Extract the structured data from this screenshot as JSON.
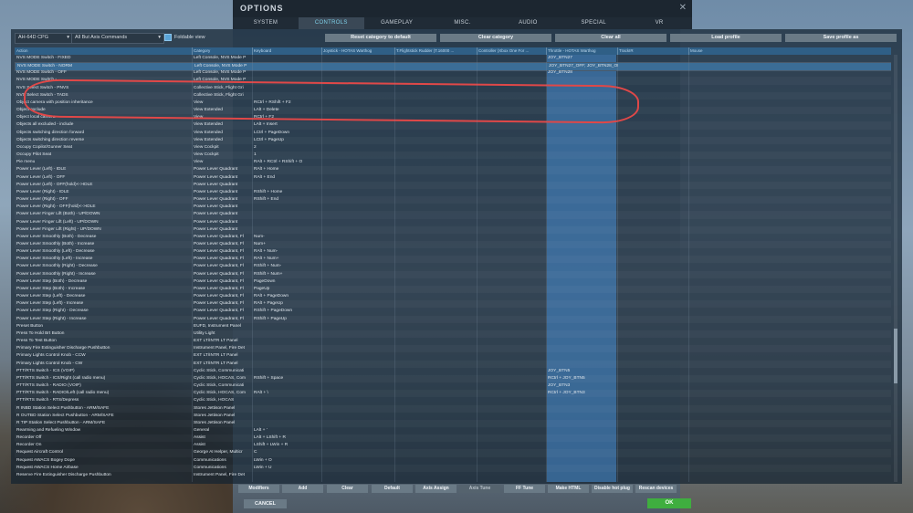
{
  "window": {
    "title": "OPTIONS",
    "close_glyph": "✕"
  },
  "tabs": [
    {
      "label": "SYSTEM"
    },
    {
      "label": "CONTROLS",
      "active": true
    },
    {
      "label": "GAMEPLAY"
    },
    {
      "label": "MISC."
    },
    {
      "label": "AUDIO"
    },
    {
      "label": "SPECIAL"
    },
    {
      "label": "VR"
    }
  ],
  "toolbar": {
    "aircraft": "AH-64D CPG",
    "category_filter": "All But Axis Commands",
    "foldable_label": "Foldable view",
    "foldable_checked": true,
    "reset_category": "Reset category to default",
    "clear_category": "Clear category",
    "clear_all": "Clear all",
    "load_profile": "Load profile",
    "save_profile": "Save profile as"
  },
  "columns": [
    "Action",
    "Category",
    "Keyboard",
    "Joystick - HOTAS Warthog",
    "T.Flightstick Rudder (T.16000 ...",
    "Controller (Xbox One For ...",
    "Throttle - HOTAS Warthog",
    "TrackIR",
    "Mouse"
  ],
  "rows": [
    [
      "NVS MODE Switch - FIXED",
      "Left Console, NVS Mode P",
      "",
      "",
      "",
      "",
      "JOY_BTN27",
      "",
      ""
    ],
    [
      "NVS MODE Switch - NORM",
      "Left Console, NVS Mode P",
      "",
      "",
      "",
      "",
      "JOY_BTN27_OFF; JOY_BTN28_OF",
      "",
      ""
    ],
    [
      "NVS MODE Switch - OFF",
      "Left Console, NVS Mode P",
      "",
      "",
      "",
      "",
      "JOY_BTN28",
      "",
      ""
    ],
    [
      "NVS MODE Switch - ...",
      "Left Console, NVS Mode P",
      "",
      "",
      "",
      "",
      "",
      "",
      ""
    ],
    [
      "NVS Select Switch - PNVS",
      "Collective Stick, Flight Gri",
      "",
      "",
      "",
      "",
      "",
      "",
      ""
    ],
    [
      "NVS Select Switch - TADS",
      "Collective Stick, Flight Gri",
      "",
      "",
      "",
      "",
      "",
      "",
      ""
    ],
    [
      "Object camera with position inheritance",
      "View",
      "RCtrl + RShift + F2",
      "",
      "",
      "",
      "",
      "",
      ""
    ],
    [
      "Object exclude",
      "View Extended",
      "LAlt + Delete",
      "",
      "",
      "",
      "",
      "",
      ""
    ],
    [
      "Object local camera",
      "View",
      "RCtrl + F2",
      "",
      "",
      "",
      "",
      "",
      ""
    ],
    [
      "Objects all excluded - include",
      "View Extended",
      "LAlt + Insert",
      "",
      "",
      "",
      "",
      "",
      ""
    ],
    [
      "Objects switching direction forward",
      "View Extended",
      "LCtrl + PageDown",
      "",
      "",
      "",
      "",
      "",
      ""
    ],
    [
      "Objects switching direction reverse",
      "View Extended",
      "LCtrl + PageUp",
      "",
      "",
      "",
      "",
      "",
      ""
    ],
    [
      "Occupy Copilot/Gunner Seat",
      "View Cockpit",
      "2",
      "",
      "",
      "",
      "",
      "",
      ""
    ],
    [
      "Occupy Pilot Seat",
      "View Cockpit",
      "1",
      "",
      "",
      "",
      "",
      "",
      ""
    ],
    [
      "Pie menu",
      "View",
      "RAlt + RCtrl + RShift + O",
      "",
      "",
      "",
      "",
      "",
      ""
    ],
    [
      "Power Lever (Left) - IDLE",
      "Power Lever Quadrant",
      "RAlt + Home",
      "",
      "",
      "",
      "",
      "",
      ""
    ],
    [
      "Power Lever (Left) - OFF",
      "Power Lever Quadrant",
      "RAlt + End",
      "",
      "",
      "",
      "",
      "",
      ""
    ],
    [
      "Power Lever (Left) - OFF(hold)<->IDLE",
      "Power Lever Quadrant",
      "",
      "",
      "",
      "",
      "",
      "",
      ""
    ],
    [
      "Power Lever (Right) - IDLE",
      "Power Lever Quadrant",
      "RShift + Home",
      "",
      "",
      "",
      "",
      "",
      ""
    ],
    [
      "Power Lever (Right) - OFF",
      "Power Lever Quadrant",
      "RShift + End",
      "",
      "",
      "",
      "",
      "",
      ""
    ],
    [
      "Power Lever (Right) - OFF(hold)<->IDLE",
      "Power Lever Quadrant",
      "",
      "",
      "",
      "",
      "",
      "",
      ""
    ],
    [
      "Power Lever Finger Lift (Both) - UP/DOWN",
      "Power Lever Quadrant",
      "",
      "",
      "",
      "",
      "",
      "",
      ""
    ],
    [
      "Power Lever Finger Lift (Left) - UP/DOWN",
      "Power Lever Quadrant",
      "",
      "",
      "",
      "",
      "",
      "",
      ""
    ],
    [
      "Power Lever Finger Lift (Right) - UP/DOWN",
      "Power Lever Quadrant",
      "",
      "",
      "",
      "",
      "",
      "",
      ""
    ],
    [
      "Power Lever Smoothly (Both) - Decrease",
      "Power Lever Quadrant, Fl",
      "Num-",
      "",
      "",
      "",
      "",
      "",
      ""
    ],
    [
      "Power Lever Smoothly (Both) - Increase",
      "Power Lever Quadrant, Fl",
      "Num+",
      "",
      "",
      "",
      "",
      "",
      ""
    ],
    [
      "Power Lever Smoothly (Left) - Decrease",
      "Power Lever Quadrant, Fl",
      "RAlt + Num-",
      "",
      "",
      "",
      "",
      "",
      ""
    ],
    [
      "Power Lever Smoothly (Left) - Increase",
      "Power Lever Quadrant, Fl",
      "RAlt + Num+",
      "",
      "",
      "",
      "",
      "",
      ""
    ],
    [
      "Power Lever Smoothly (Right) - Decrease",
      "Power Lever Quadrant, Fl",
      "RShift + Num-",
      "",
      "",
      "",
      "",
      "",
      ""
    ],
    [
      "Power Lever Smoothly (Right) - Increase",
      "Power Lever Quadrant, Fl",
      "RShift + Num+",
      "",
      "",
      "",
      "",
      "",
      ""
    ],
    [
      "Power Lever Step (Both) - Decrease",
      "Power Lever Quadrant, Fl",
      "PageDown",
      "",
      "",
      "",
      "",
      "",
      ""
    ],
    [
      "Power Lever Step (Both) - Increase",
      "Power Lever Quadrant, Fl",
      "PageUp",
      "",
      "",
      "",
      "",
      "",
      ""
    ],
    [
      "Power Lever Step (Left) - Decrease",
      "Power Lever Quadrant, Fl",
      "RAlt + PageDown",
      "",
      "",
      "",
      "",
      "",
      ""
    ],
    [
      "Power Lever Step (Left) - Increase",
      "Power Lever Quadrant, Fl",
      "RAlt + PageUp",
      "",
      "",
      "",
      "",
      "",
      ""
    ],
    [
      "Power Lever Step (Right) - Decrease",
      "Power Lever Quadrant, Fl",
      "RShift + PageDown",
      "",
      "",
      "",
      "",
      "",
      ""
    ],
    [
      "Power Lever Step (Right) - Increase",
      "Power Lever Quadrant, Fl",
      "RShift + PageUp",
      "",
      "",
      "",
      "",
      "",
      ""
    ],
    [
      "Preset Button",
      "EUFD, Instrument Panel",
      "",
      "",
      "",
      "",
      "",
      "",
      ""
    ],
    [
      "Press To Hold Brt Button",
      "Utility Light",
      "",
      "",
      "",
      "",
      "",
      "",
      ""
    ],
    [
      "Press To Test Button",
      "EXT LT/INTR LT Panel",
      "",
      "",
      "",
      "",
      "",
      "",
      ""
    ],
    [
      "Primary Fire Extinguisher Discharge Pushbutton",
      "Instrument Panel, Fire Det",
      "",
      "",
      "",
      "",
      "",
      "",
      ""
    ],
    [
      "Primary Lights Control Knob - CCW",
      "EXT LT/INTR LT Panel",
      "",
      "",
      "",
      "",
      "",
      "",
      ""
    ],
    [
      "Primary Lights Control Knob - CW",
      "EXT LT/INTR LT Panel",
      "",
      "",
      "",
      "",
      "",
      "",
      ""
    ],
    [
      "PTT/RTS Switch - ICS (VOIP)",
      "Cyclic Stick, Communicati",
      "",
      "",
      "",
      "",
      "JOY_BTN5",
      "",
      ""
    ],
    [
      "PTT/RTS Switch - ICS/Right (call radio menu)",
      "Cyclic Stick, HOCAS, Com",
      "RShift + Space",
      "",
      "",
      "",
      "RCtrl + JOY_BTN5",
      "",
      ""
    ],
    [
      "PTT/RTS Switch - RADIO (VOIP)",
      "Cyclic Stick, Communicati",
      "",
      "",
      "",
      "",
      "JOY_BTN3",
      "",
      ""
    ],
    [
      "PTT/RTS Switch - RADIO/Left (call radio menu)",
      "Cyclic Stick, HOCAS, Com",
      "RAlt + \\",
      "",
      "",
      "",
      "RCtrl + JOY_BTN3",
      "",
      ""
    ],
    [
      "PTT/RTS Switch - RTS/Depress",
      "Cyclic Stick, HOCAS",
      "",
      "",
      "",
      "",
      "",
      "",
      ""
    ],
    [
      "R INBD Station Select Pushbutton - ARM/SAFE",
      "Stores Jettison Panel",
      "",
      "",
      "",
      "",
      "",
      "",
      ""
    ],
    [
      "R OUTBD Station Select Pushbutton - ARM/SAFE",
      "Stores Jettison Panel",
      "",
      "",
      "",
      "",
      "",
      "",
      ""
    ],
    [
      "R TIP Station Select Pushbutton - ARM/SAFE",
      "Stores Jettison Panel",
      "",
      "",
      "",
      "",
      "",
      "",
      ""
    ],
    [
      "Rearming and Refueling Window",
      "General",
      "LAlt + '",
      "",
      "",
      "",
      "",
      "",
      ""
    ],
    [
      "Recorder Off",
      "Assist",
      "LAlt + LShift + R",
      "",
      "",
      "",
      "",
      "",
      ""
    ],
    [
      "Recorder On",
      "Assist",
      "LShift + LWin + R",
      "",
      "",
      "",
      "",
      "",
      ""
    ],
    [
      "Request Aircraft Control",
      "George AI Helper, Multicr",
      "C",
      "",
      "",
      "",
      "",
      "",
      ""
    ],
    [
      "Request AWACS Bogey Dope",
      "Communications",
      "LWin + O",
      "",
      "",
      "",
      "",
      "",
      ""
    ],
    [
      "Request AWACS Home Airbase",
      "Communications",
      "LWin + U",
      "",
      "",
      "",
      "",
      "",
      ""
    ],
    [
      "Reserve Fire Extinguisher Discharge Pushbutton",
      "Instrument Panel, Fire Det",
      "",
      "",
      "",
      "",
      "",
      "",
      ""
    ]
  ],
  "bottom_buttons": [
    {
      "label": "Modifiers"
    },
    {
      "label": "Add"
    },
    {
      "label": "Clear"
    },
    {
      "label": "Default"
    },
    {
      "label": "Axis Assign"
    },
    {
      "label": "Axis Tune",
      "dim": true
    },
    {
      "label": "FF Tune"
    },
    {
      "label": "Make HTML"
    },
    {
      "label": "Disable hot plug"
    },
    {
      "label": "Rescan devices"
    }
  ],
  "footer": {
    "cancel": "CANCEL",
    "ok": "OK"
  },
  "colors": {
    "accent": "#7fd0e8",
    "selected_row": "#3b6d96",
    "highlight_column": "#4a8cd2",
    "annotation": "#e04848",
    "ok": "#3fae3f"
  }
}
